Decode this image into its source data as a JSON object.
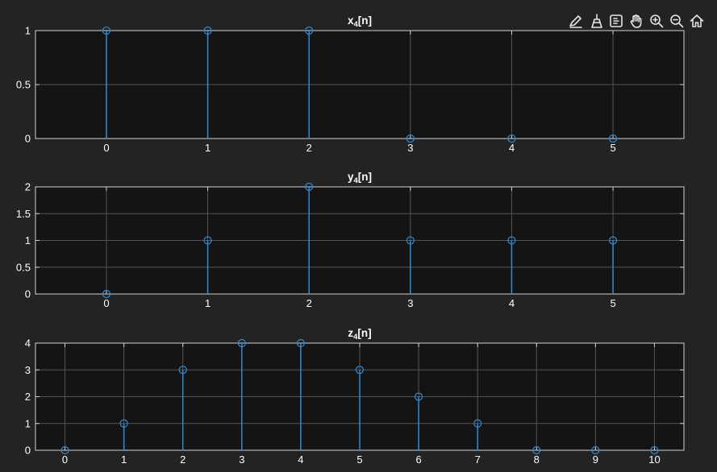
{
  "toolbar": {
    "icons": [
      "edit-brush-icon",
      "data-brush-icon",
      "data-tips-icon",
      "pan-hand-icon",
      "zoom-in-icon",
      "zoom-out-icon",
      "home-icon"
    ]
  },
  "colors": {
    "background": "#232323",
    "axes_background": "#141414",
    "axis_line": "#d0d0d0",
    "grid": "#555555",
    "tick_text": "#ffffff",
    "title_text": "#ffffff",
    "stem": "#2b8bd6"
  },
  "chart_data": [
    {
      "type": "stem",
      "title_main": "x",
      "title_sub": "4",
      "title_tail": "[n]",
      "x": [
        0,
        1,
        2,
        3,
        4,
        5
      ],
      "values": [
        1,
        1,
        1,
        0,
        0,
        0
      ],
      "xlim": [
        -0.7,
        5.7
      ],
      "ylim": [
        0,
        1
      ],
      "xticks": [
        0,
        1,
        2,
        3,
        4,
        5
      ],
      "yticks": [
        0,
        0.5,
        1
      ],
      "ytick_labels": [
        "0",
        "0.5",
        "1"
      ],
      "grid": true
    },
    {
      "type": "stem",
      "title_main": "y",
      "title_sub": "4",
      "title_tail": "[n]",
      "x": [
        0,
        1,
        2,
        3,
        4,
        5
      ],
      "values": [
        0,
        1,
        2,
        1,
        1,
        1
      ],
      "xlim": [
        -0.7,
        5.7
      ],
      "ylim": [
        0,
        2
      ],
      "xticks": [
        0,
        1,
        2,
        3,
        4,
        5
      ],
      "yticks": [
        0,
        0.5,
        1,
        1.5,
        2
      ],
      "ytick_labels": [
        "0",
        "0.5",
        "1",
        "1.5",
        "2"
      ],
      "grid": true
    },
    {
      "type": "stem",
      "title_main": "z",
      "title_sub": "4",
      "title_tail": "[n]",
      "x": [
        0,
        1,
        2,
        3,
        4,
        5,
        6,
        7,
        8,
        9,
        10
      ],
      "values": [
        0,
        1,
        3,
        4,
        4,
        3,
        2,
        1,
        0,
        0,
        0
      ],
      "xlim": [
        -0.5,
        10.5
      ],
      "ylim": [
        0,
        4
      ],
      "xticks": [
        0,
        1,
        2,
        3,
        4,
        5,
        6,
        7,
        8,
        9,
        10
      ],
      "yticks": [
        0,
        1,
        2,
        3,
        4
      ],
      "ytick_labels": [
        "0",
        "1",
        "2",
        "3",
        "4"
      ],
      "grid": true
    }
  ]
}
